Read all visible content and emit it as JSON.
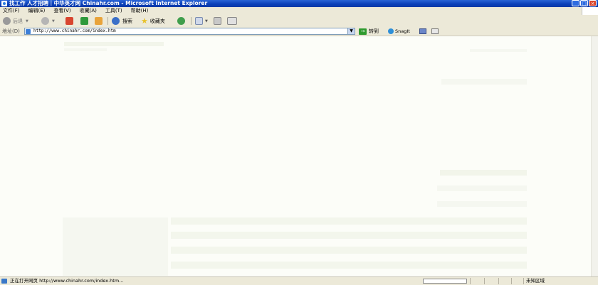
{
  "window": {
    "title": "找工作 人才招聘｜中华英才网 Chinahr.com - Microsoft Internet Explorer",
    "buttons": {
      "minimize": "_",
      "maximize": "□",
      "close": "×"
    }
  },
  "menubar": {
    "items": [
      {
        "label": "文件(F)"
      },
      {
        "label": "编辑(E)"
      },
      {
        "label": "查看(V)"
      },
      {
        "label": "收藏(A)"
      },
      {
        "label": "工具(T)"
      },
      {
        "label": "帮助(H)"
      }
    ]
  },
  "toolbar": {
    "back_label": "后退",
    "search_label": "搜索",
    "favorites_label": "收藏夹",
    "colors": {
      "back": "#9a9a9a",
      "forward": "#b5b5b5",
      "stop": "#d8452f",
      "refresh": "#2f9a3c",
      "home": "#e8a33a",
      "search": "#3a6fc8",
      "favorites": "#e8c22a",
      "history": "#3f9e4c"
    }
  },
  "addressbar": {
    "label": "地址(D)",
    "url": "http://www.chinahr.com/index.htm",
    "go_label": "转到",
    "snagit_label": "SnagIt"
  },
  "statusbar": {
    "text": "正在打开网页 http://www.chinahr.com/index.htm...",
    "zone": "未知区域"
  }
}
